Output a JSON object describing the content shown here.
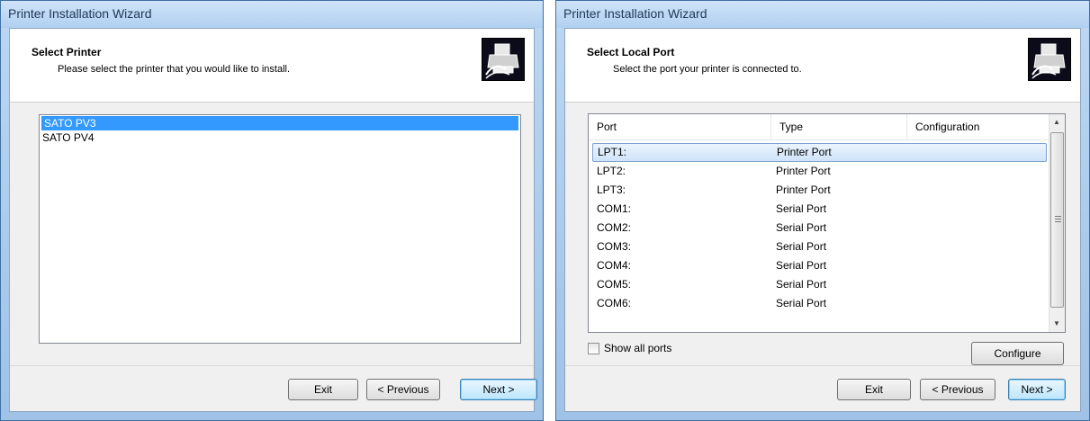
{
  "wizard1": {
    "title": "Printer Installation Wizard",
    "header_title": "Select Printer",
    "header_subtitle": "Please select the printer that you would like to install.",
    "printers": [
      "SATO PV3",
      "SATO PV4"
    ],
    "selected_index": 0,
    "buttons": {
      "exit": "Exit",
      "previous": "< Previous",
      "next": "Next >"
    }
  },
  "wizard2": {
    "title": "Printer Installation Wizard",
    "header_title": "Select Local Port",
    "header_subtitle": "Select the port your printer is connected to.",
    "columns": [
      "Port",
      "Type",
      "Configuration"
    ],
    "ports": [
      {
        "port": "LPT1:",
        "type": "Printer Port",
        "configuration": ""
      },
      {
        "port": "LPT2:",
        "type": "Printer Port",
        "configuration": ""
      },
      {
        "port": "LPT3:",
        "type": "Printer Port",
        "configuration": ""
      },
      {
        "port": "COM1:",
        "type": "Serial Port",
        "configuration": ""
      },
      {
        "port": "COM2:",
        "type": "Serial Port",
        "configuration": ""
      },
      {
        "port": "COM3:",
        "type": "Serial Port",
        "configuration": ""
      },
      {
        "port": "COM4:",
        "type": "Serial Port",
        "configuration": ""
      },
      {
        "port": "COM5:",
        "type": "Serial Port",
        "configuration": ""
      },
      {
        "port": "COM6:",
        "type": "Serial Port",
        "configuration": ""
      }
    ],
    "selected_index": 0,
    "show_all_ports_label": "Show all ports",
    "show_all_ports_checked": false,
    "buttons": {
      "configure": "Configure",
      "exit": "Exit",
      "previous": "< Previous",
      "next": "Next >"
    }
  },
  "icons": {
    "wizard_icon": "printer-icon",
    "scroll_up": "arrow-up-icon",
    "scroll_down": "arrow-down-icon"
  }
}
